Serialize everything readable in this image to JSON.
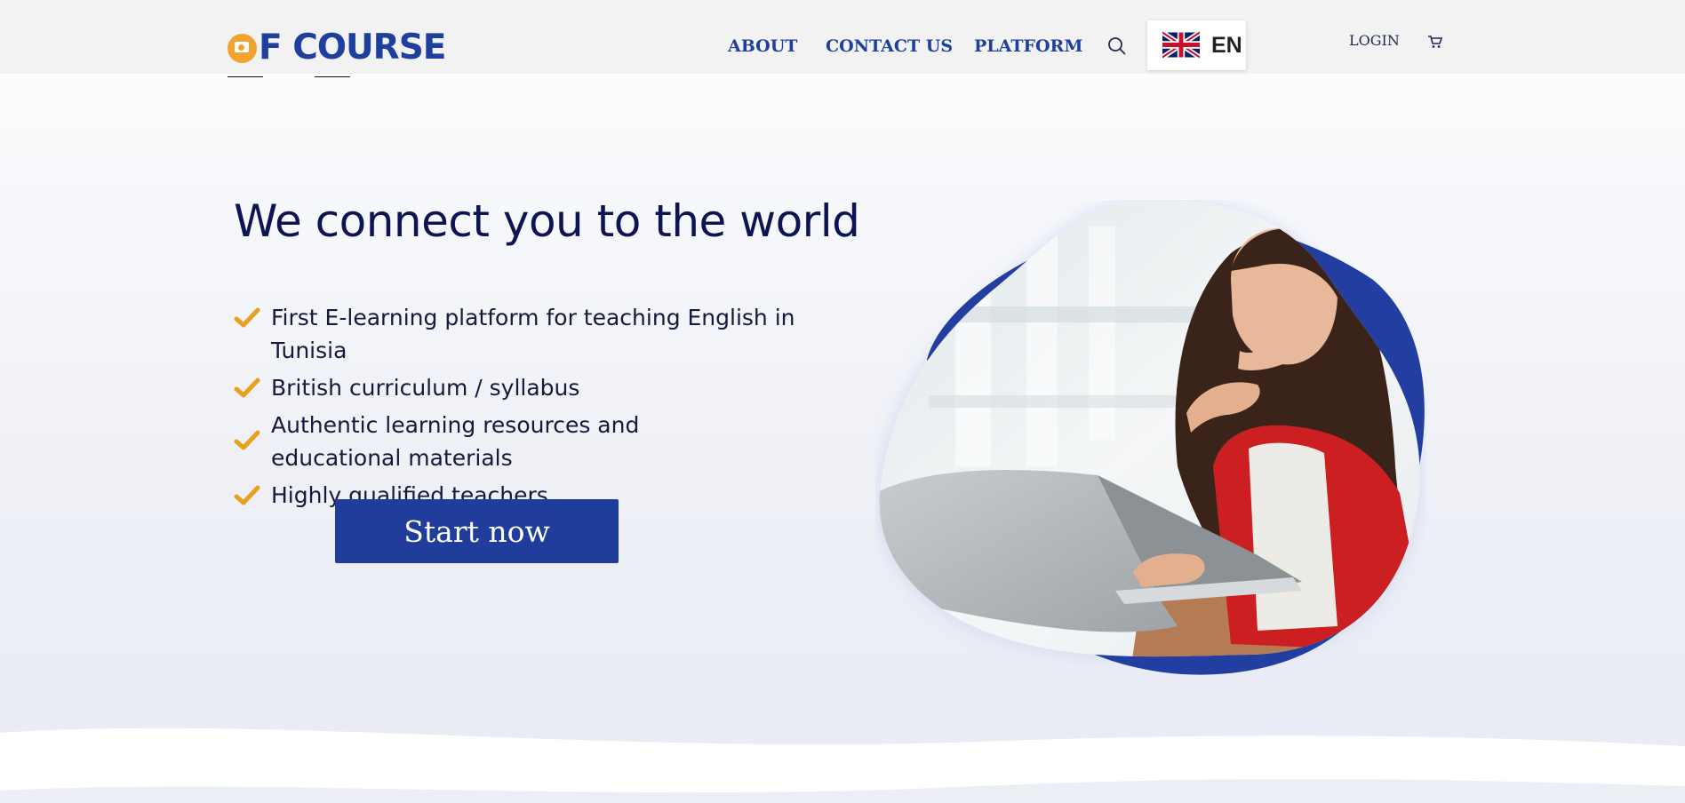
{
  "header": {
    "logo_text": "F COURSE",
    "nav": [
      {
        "label": "ABOUT"
      },
      {
        "label": "CONTACT US"
      },
      {
        "label": "PLATFORM"
      }
    ],
    "language": {
      "code": "EN",
      "flag": "uk-flag-icon"
    },
    "login_label": "LOGIN"
  },
  "hero": {
    "title": "We connect you to the world",
    "features": [
      "First E-learning platform for teaching English in Tunisia",
      "British curriculum / syllabus",
      "Authentic learning resources and educational materials",
      "Highly qualified teachers"
    ],
    "cta_label": "Start now",
    "image": "woman-at-laptop-photo"
  },
  "colors": {
    "brand_blue": "#1f3f9e",
    "button_blue": "#213d9c",
    "accent_orange": "#f2a22e",
    "title_navy": "#0d1454"
  }
}
